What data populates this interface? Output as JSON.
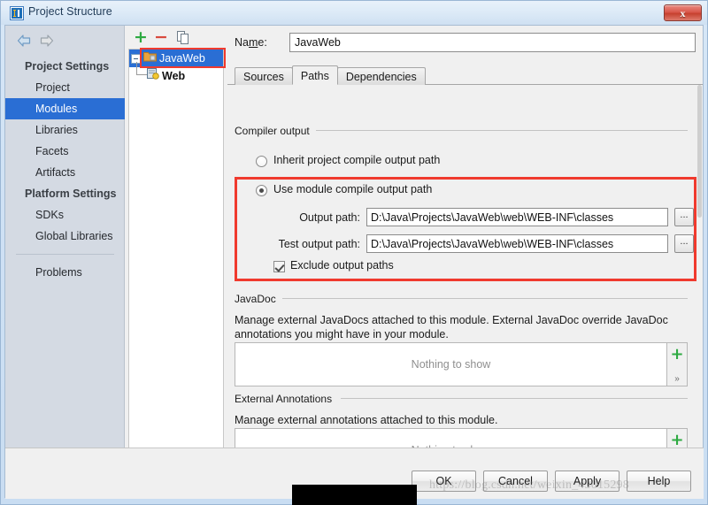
{
  "window": {
    "title": "Project Structure",
    "app_icon": "intellij-idea-icon",
    "close_label": "x"
  },
  "sidebar": {
    "nav": {
      "back_icon": "arrow-left-icon",
      "forward_icon": "arrow-right-icon"
    },
    "groups": [
      {
        "label": "Project Settings",
        "items": [
          {
            "label": "Project",
            "selected": false
          },
          {
            "label": "Modules",
            "selected": true
          },
          {
            "label": "Libraries",
            "selected": false
          },
          {
            "label": "Facets",
            "selected": false
          },
          {
            "label": "Artifacts",
            "selected": false
          }
        ]
      },
      {
        "label": "Platform Settings",
        "items": [
          {
            "label": "SDKs",
            "selected": false
          },
          {
            "label": "Global Libraries",
            "selected": false
          }
        ]
      }
    ],
    "extra_items": [
      {
        "label": "Problems",
        "selected": false
      }
    ]
  },
  "tree": {
    "toolbar": {
      "add_icon": "plus-icon",
      "remove_icon": "minus-icon",
      "copy_icon": "copy-icon"
    },
    "nodes": [
      {
        "label": "JavaWeb",
        "icon": "module-folder-icon",
        "selected": true,
        "expanded": true,
        "highlighted": true
      },
      {
        "label": "Web",
        "icon": "web-facet-icon",
        "selected": false
      }
    ]
  },
  "module": {
    "name_label": "Name:",
    "name_value": "JavaWeb",
    "tabs": [
      {
        "label": "Sources",
        "active": false
      },
      {
        "label": "Paths",
        "active": true
      },
      {
        "label": "Dependencies",
        "active": false
      }
    ]
  },
  "compiler_output": {
    "group_title": "Compiler output",
    "inherit_option": {
      "label": "Inherit project compile output path",
      "checked": false
    },
    "module_option": {
      "label": "Use module compile output path",
      "checked": true
    },
    "output_path": {
      "label": "Output path:",
      "value": "D:\\Java\\Projects\\JavaWeb\\web\\WEB-INF\\classes",
      "browse_label": "..."
    },
    "test_output_path": {
      "label": "Test output path:",
      "value": "D:\\Java\\Projects\\JavaWeb\\web\\WEB-INF\\classes",
      "browse_label": "..."
    },
    "exclude_checkbox": {
      "label": "Exclude output paths",
      "checked": true
    },
    "highlight_color": "#f03a2e"
  },
  "javadoc": {
    "group_title": "JavaDoc",
    "description": "Manage external JavaDocs attached to this module. External JavaDoc override JavaDoc annotations you might have in your module.",
    "empty_text": "Nothing to show",
    "add_icon": "plus-icon",
    "expand_icon": "chevron-double-right-icon"
  },
  "external_annotations": {
    "group_title": "External Annotations",
    "description": "Manage external annotations attached to this module.",
    "empty_text": "Nothing to show",
    "add_icon": "plus-icon",
    "expand_icon": "chevron-double-right-icon"
  },
  "buttons": {
    "ok": "OK",
    "cancel": "Cancel",
    "apply": "Apply",
    "help": "Help"
  },
  "watermark": {
    "text": "https://blog.csdn.net/weixin_43015298"
  },
  "colors": {
    "accent_selection": "#2a6ed4",
    "highlight_red": "#f03a2e",
    "add_green": "#2eaa42",
    "remove_red": "#d94a3d"
  }
}
